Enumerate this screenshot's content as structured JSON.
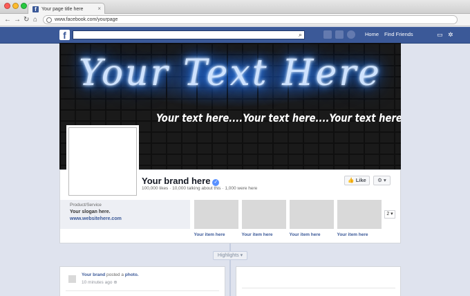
{
  "browser": {
    "tab_title": "Your page title here",
    "tab_close": "×",
    "url": "www.facebook.com/yourpage",
    "back_glyph": "←",
    "forward_glyph": "→",
    "reload_glyph": "↻",
    "home_glyph": "⌂",
    "traffic_lights": [
      "#fc5c56",
      "#fdbb2d",
      "#27c940"
    ]
  },
  "facebook_bar": {
    "logo": "f",
    "search_icon": "⌕",
    "home_label": "Home",
    "find_friends_label": "Find Friends",
    "settings_glyph": "✲",
    "brand_color": "#3b5998"
  },
  "cover": {
    "neon_text": "Your Text Here",
    "subline": "Your text here....Your text here....Your text here...."
  },
  "profile": {
    "brand_name": "Your brand here",
    "verified_glyph": "✓",
    "stats": "100,000 likes · 10,000 talking about this · 1,000 were here",
    "like_label": "👍 Like",
    "gear_label": "⚙ ▾",
    "category": "Product/Service",
    "slogan": "Your slogan here.",
    "website": "www.websitehere.com",
    "items": [
      {
        "label": "Your item here"
      },
      {
        "label": "Your item here"
      },
      {
        "label": "Your item here"
      },
      {
        "label": "Your item here"
      }
    ],
    "pager_label": "2 ▾"
  },
  "timeline": {
    "highlights_label": "Highlights ▾",
    "post_author": "Your brand",
    "post_action": " posted a ",
    "post_object": "photo.",
    "post_time": "10 minutes ago ⊕"
  }
}
